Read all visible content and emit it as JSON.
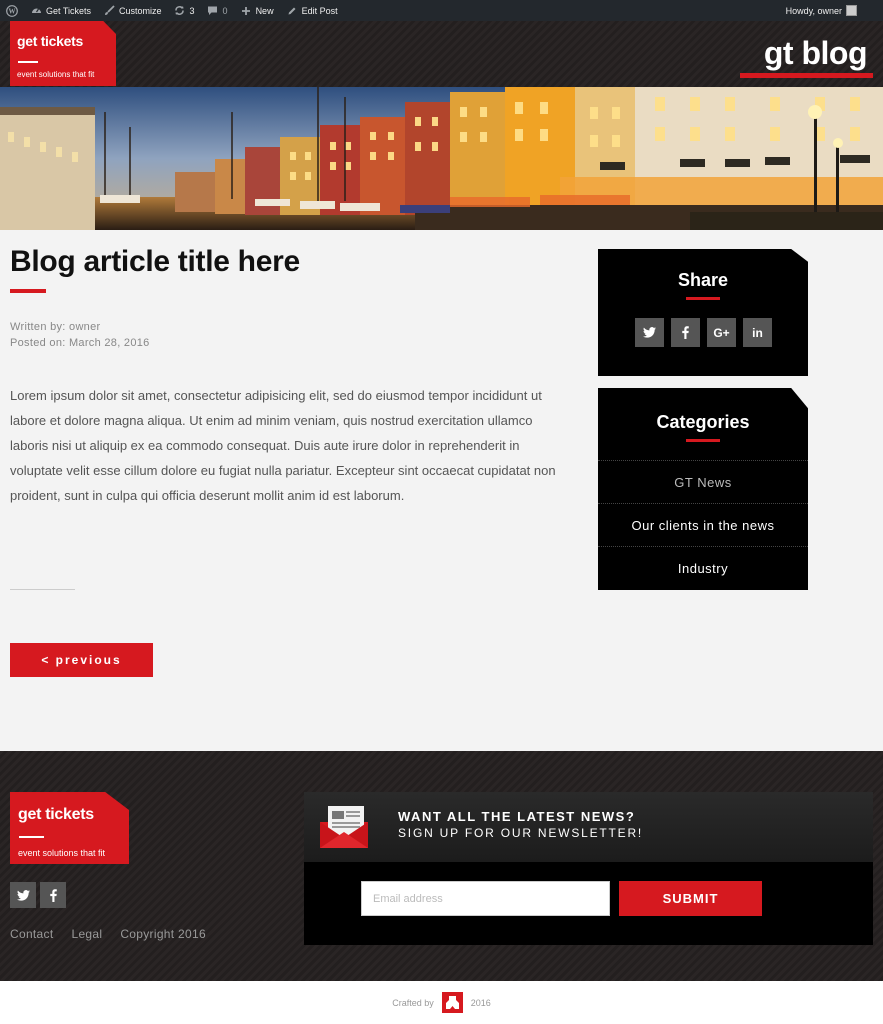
{
  "adminbar": {
    "site_name": "Get Tickets",
    "customize": "Customize",
    "updates_count": "3",
    "comments_count": "0",
    "new_label": "New",
    "edit_label": "Edit Post",
    "howdy": "Howdy, owner"
  },
  "header": {
    "logo_text": "get tickets",
    "logo_tagline": "event solutions that fit",
    "blog_title": "gt blog"
  },
  "article": {
    "title": "Blog article title here",
    "author_line": "Written by: owner",
    "date_line": "Posted on: March 28, 2016",
    "body": "Lorem ipsum dolor sit amet, consectetur adipisicing elit, sed do eiusmod tempor incididunt ut labore et dolore magna aliqua. Ut enim ad minim veniam, quis nostrud exercitation ullamco laboris nisi ut aliquip ex ea commodo consequat. Duis aute irure dolor in reprehenderit in voluptate velit esse cillum dolore eu fugiat nulla pariatur. Excepteur sint occaecat cupidatat non proident, sunt in culpa qui officia deserunt mollit anim id est laborum.",
    "previous_label": "< previous"
  },
  "sidebar": {
    "share_title": "Share",
    "share_buttons": [
      "twitter-icon",
      "facebook-icon",
      "google-plus-icon",
      "linkedin-icon"
    ],
    "categories_title": "Categories",
    "categories": [
      {
        "label": "GT News"
      },
      {
        "label": "Our clients in the news"
      },
      {
        "label": "Industry"
      }
    ]
  },
  "footer": {
    "logo_text": "get tickets",
    "logo_tagline": "event solutions that fit",
    "links": [
      "Contact",
      "Legal",
      "Copyright 2016"
    ],
    "newsletter_heading": "WANT ALL THE LATEST NEWS?",
    "newsletter_sub": "SIGN UP FOR OUR NEWSLETTER!",
    "email_placeholder": "Email address",
    "submit_label": "SUBMIT",
    "crafted_by": "Crafted by",
    "crafted_year": "2016"
  },
  "colors": {
    "accent": "#d6191f",
    "admin_bar": "#23282d",
    "dark_bg": "#231f1f"
  }
}
